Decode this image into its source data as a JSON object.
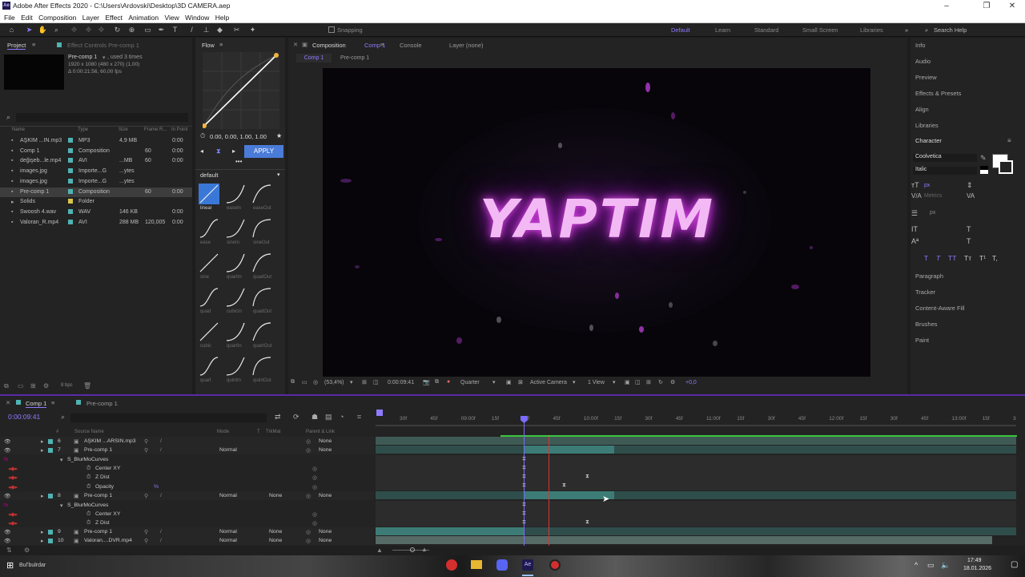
{
  "window": {
    "title": "Adobe After Effects 2020 - C:\\Users\\Ardovski\\Desktop\\3D CAMERA.aep",
    "app_icon": "Ae"
  },
  "menu": [
    "File",
    "Edit",
    "Composition",
    "Layer",
    "Effect",
    "Animation",
    "View",
    "Window",
    "Help"
  ],
  "toolbar": {
    "snapping": "Snapping",
    "workspaces": [
      "Default",
      "Learn",
      "Standard",
      "Small Screen",
      "Libraries"
    ],
    "search_placeholder": "Search Help"
  },
  "project": {
    "tab": "Project",
    "effect_controls_tab": "Effect Controls Pre-comp 1",
    "item_name": "Pre-comp 1",
    "item_used": ", used 3 times",
    "item_size": "1920 x 1080  (480 x 270) (1,00)",
    "item_duration": "Δ 0:00:21:56, 60,00 fps",
    "columns": [
      "Name",
      "Type",
      "Size",
      "Frame R...",
      "In Point"
    ],
    "items": [
      {
        "name": "AŞKIM ...IN.mp3",
        "type": "MP3",
        "size": "4,9 MB",
        "fr": "",
        "in": "0:00",
        "color": "#4fb3b3"
      },
      {
        "name": "Comp 1",
        "type": "Composition",
        "size": "",
        "fr": "60",
        "in": "0:00",
        "color": "#4fb3b3"
      },
      {
        "name": "değişeb...le.mp4",
        "type": "AVI",
        "size": "...MB",
        "fr": "60",
        "in": "0:00",
        "color": "#4fb3b3"
      },
      {
        "name": "images.jpg",
        "type": "Importe...G",
        "size": "...ytes",
        "fr": "",
        "in": "",
        "color": "#4fb3b3"
      },
      {
        "name": "images.jpg",
        "type": "Importe...G",
        "size": "...ytes",
        "fr": "",
        "in": "",
        "color": "#4fb3b3"
      },
      {
        "name": "Pre-comp 1",
        "type": "Composition",
        "size": "",
        "fr": "60",
        "in": "0:00",
        "color": "#4fb3b3"
      },
      {
        "name": "Solids",
        "type": "Folder",
        "size": "",
        "fr": "",
        "in": "",
        "color": "#d8c44a"
      },
      {
        "name": "Swoosh 4.wav",
        "type": "WAV",
        "size": "146 KB",
        "fr": "",
        "in": "0:00",
        "color": "#4fb3b3"
      },
      {
        "name": "Valoran_R.mp4",
        "type": "AVI",
        "size": "288 MB",
        "fr": "120,005",
        "in": "0:00",
        "color": "#4fb3b3"
      }
    ],
    "bpc": "8 bpc"
  },
  "flow": {
    "tab": "Flow",
    "values": "0.00, 0.00, 1.00, 1.00",
    "apply": "APPLY",
    "preset": "default",
    "curves": [
      "linear",
      "easeIn",
      "easeOut",
      "ease",
      "sineIn",
      "sineOut",
      "sine",
      "quartIn",
      "quadOut",
      "quad",
      "cubicIn",
      "quadOut",
      "cubic",
      "quartIn",
      "quartOut",
      "quart",
      "quintIn",
      "quintOut"
    ]
  },
  "composition": {
    "tab": "Composition",
    "comp_name": "Comp 1",
    "console_tab": "Console",
    "layer_tab": "Layer (none)",
    "breadcrumbs": [
      "Comp 1",
      "Pre-comp 1"
    ],
    "viewer_text": "YAPTIM",
    "zoom": "(53,4%)",
    "timecode": "0:00:09:41",
    "resolution": "Quarter",
    "camera": "Active Camera",
    "views": "1 View"
  },
  "right_panels": [
    "Info",
    "Audio",
    "Preview",
    "Effects & Presets",
    "Align",
    "Libraries",
    "Character",
    "Paragraph",
    "Tracker",
    "Content-Aware Fill",
    "Brushes",
    "Paint"
  ],
  "character": {
    "font": "Coolvetica",
    "style": "Italic",
    "unit": "px",
    "metrics": "Metrics",
    "text_buttons": [
      "T",
      "T",
      "TT",
      "Tт",
      "T¹",
      "T,"
    ]
  },
  "timeline": {
    "tabs": [
      "Comp 1",
      "Pre-comp 1"
    ],
    "timecode": "0:00:09:41",
    "columns": [
      "#",
      "Source Name",
      "Mode",
      "T",
      "TrkMat",
      "Parent & Link"
    ],
    "ticks": [
      "30f",
      "45f",
      "09:00f",
      "15f",
      "30f",
      "45f",
      "10:00f",
      "15f",
      "30f",
      "45f",
      "11:00f",
      "15f",
      "30f",
      "45f",
      "12:00f",
      "15f",
      "30f",
      "45f",
      "13:00f",
      "15f",
      "3"
    ],
    "layers": [
      {
        "num": "6",
        "name": "AŞKIM ...ARSIN.mp3",
        "mode": "",
        "trk": "",
        "parent": "None",
        "kind": "layer"
      },
      {
        "num": "7",
        "name": "Pre-comp 1",
        "mode": "Normal",
        "trk": "",
        "parent": "None",
        "kind": "layer"
      },
      {
        "num": "",
        "name": "S_BlurMoCurves",
        "mode": "",
        "trk": "",
        "parent": "",
        "kind": "effect"
      },
      {
        "num": "",
        "name": "Center XY",
        "mode": "",
        "trk": "",
        "parent": "",
        "kind": "prop"
      },
      {
        "num": "",
        "name": "Z Dist",
        "mode": "",
        "trk": "",
        "parent": "",
        "kind": "prop"
      },
      {
        "num": "",
        "name": "Opacity",
        "mode": "",
        "trk": "",
        "parent": "",
        "kind": "prop",
        "value": "%"
      },
      {
        "num": "8",
        "name": "Pre-comp 1",
        "mode": "Normal",
        "trk": "None",
        "parent": "None",
        "kind": "layer"
      },
      {
        "num": "",
        "name": "S_BlurMoCurves",
        "mode": "",
        "trk": "",
        "parent": "",
        "kind": "effect"
      },
      {
        "num": "",
        "name": "Center XY",
        "mode": "",
        "trk": "",
        "parent": "",
        "kind": "prop"
      },
      {
        "num": "",
        "name": "Z Dist",
        "mode": "",
        "trk": "",
        "parent": "",
        "kind": "prop"
      },
      {
        "num": "9",
        "name": "Pre-comp 1",
        "mode": "Normal",
        "trk": "None",
        "parent": "None",
        "kind": "layer"
      },
      {
        "num": "10",
        "name": "Valoran....DVR.mp4",
        "mode": "Normal",
        "trk": "None",
        "parent": "None",
        "kind": "layer"
      }
    ]
  },
  "taskbar": {
    "search": "Bul'bulrdar",
    "time": "17:49",
    "date": "18.01.2026"
  }
}
